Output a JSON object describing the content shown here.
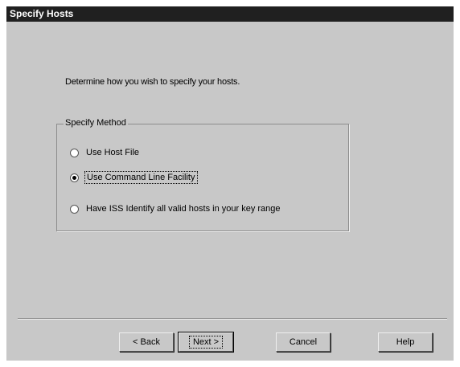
{
  "window": {
    "title": "Specify Hosts"
  },
  "intro_text": "Determine how you wish to specify your hosts.",
  "group": {
    "label": "Specify Method",
    "options": [
      {
        "label": "Use Host File",
        "selected": false
      },
      {
        "label": "Use Command Line Facility",
        "selected": true
      },
      {
        "label": "Have ISS Identify all valid hosts in your key range",
        "selected": false
      }
    ]
  },
  "buttons": {
    "back": "< Back",
    "next": "Next >",
    "cancel": "Cancel",
    "help": "Help"
  },
  "colors": {
    "dialog_bg": "#c8c8c8",
    "titlebar_bg": "#202020",
    "titlebar_text": "#ffffff"
  }
}
